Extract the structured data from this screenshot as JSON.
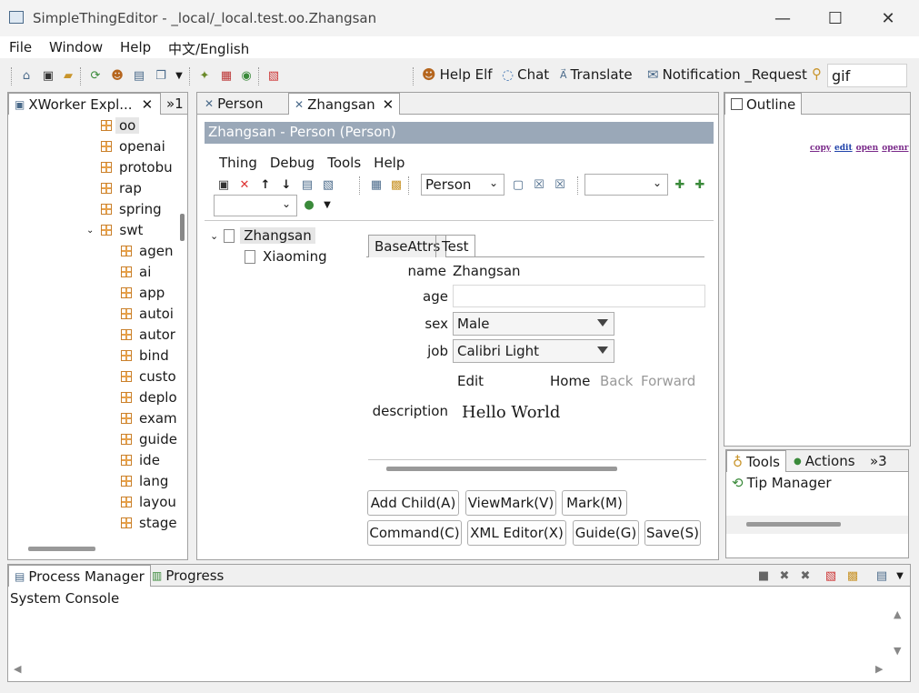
{
  "window": {
    "title": "SimpleThingEditor - _local/_local.test.oo.Zhangsan",
    "minimize": "—",
    "maximize": "☐",
    "close": "✕"
  },
  "menu": [
    "File",
    "Window",
    "Help",
    "中文/English"
  ],
  "toolbar": {
    "links": [
      "Help Elf",
      "Chat",
      "Translate",
      "Notification _Request"
    ],
    "search_value": "gif"
  },
  "explorer": {
    "tab_label": "XWorker Expl...",
    "overflow": "»1",
    "items": [
      "oo",
      "openai",
      "protobu",
      "rap",
      "spring",
      "swt",
      "agen",
      "ai",
      "app",
      "autoi",
      "autor",
      "bind",
      "custo",
      "deplo",
      "exam",
      "guide",
      "ide",
      "lang",
      "layou",
      "stage"
    ],
    "selected": "oo",
    "expanded": "swt"
  },
  "editor": {
    "tabs": [
      {
        "label": "Person"
      },
      {
        "label": "Zhangsan"
      }
    ],
    "header": "Zhangsan - Person  (Person)",
    "menu": [
      "Thing",
      "Debug",
      "Tools",
      "Help"
    ],
    "thing_type": "Person",
    "tree": {
      "root": "Zhangsan",
      "child": "Xiaoming"
    },
    "form_tabs": [
      "BaseAttrs",
      "Test"
    ],
    "fields": {
      "name_label": "name",
      "name_value": "Zhangsan",
      "age_label": "age",
      "age_value": "",
      "sex_label": "sex",
      "sex_value": "Male",
      "job_label": "job",
      "job_value": "Calibri Light",
      "description_label": "description",
      "description_value": "Hello World"
    },
    "desc_toolbar": {
      "edit": "Edit",
      "home": "Home",
      "back": "Back",
      "forward": "Forward"
    },
    "buttons": {
      "add_child": "Add Child(A)",
      "viewmark": "ViewMark(V)",
      "mark": "Mark(M)",
      "command": "Command(C)",
      "xml_editor": "XML Editor(X)",
      "guide": "Guide(G)",
      "save": "Save(S)"
    }
  },
  "outline": {
    "tab_label": "Outline",
    "links": [
      "copy",
      "edit",
      "open",
      "openr"
    ]
  },
  "tools_panel": {
    "tabs": [
      "Tools",
      "Actions",
      "»3"
    ],
    "items": [
      "Tip Manager"
    ]
  },
  "bottom": {
    "tabs": [
      "Process Manager",
      "Progress"
    ],
    "console_title": "System Console"
  }
}
